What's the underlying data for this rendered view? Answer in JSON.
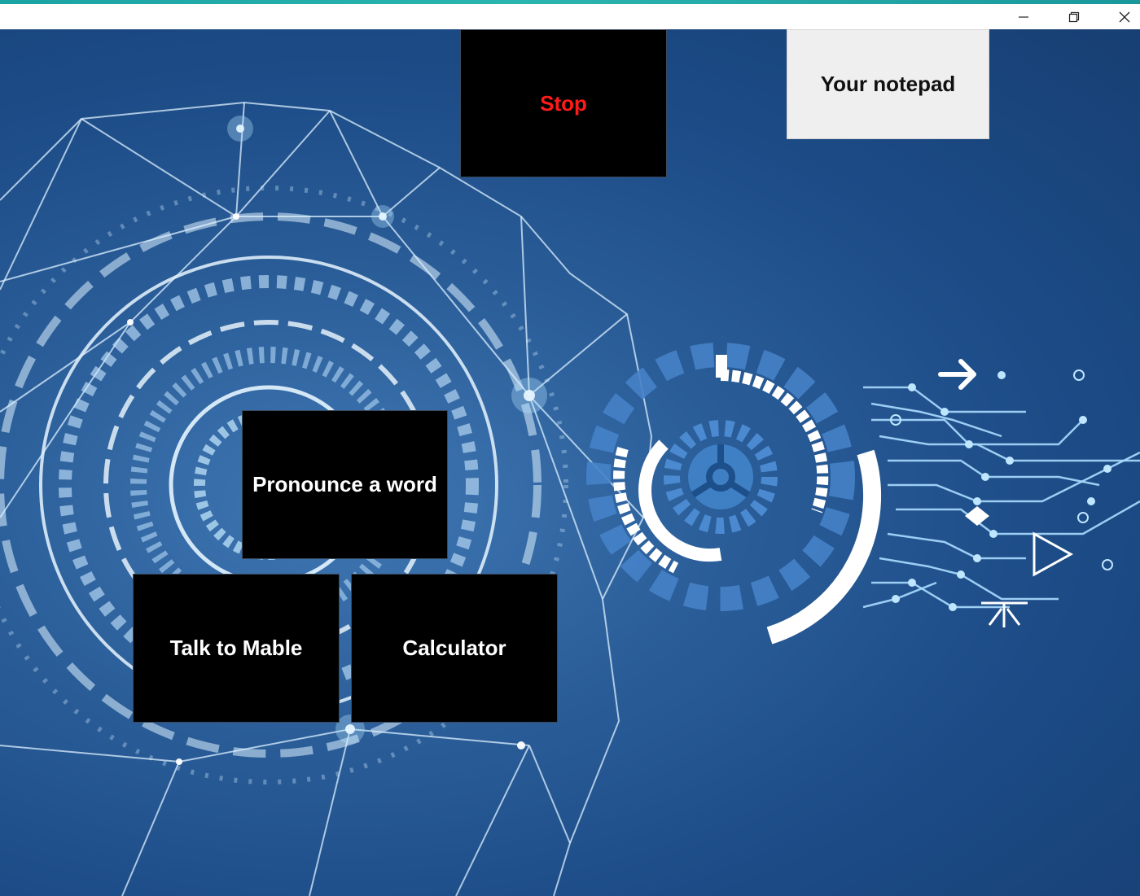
{
  "window": {
    "controls": {
      "minimize_icon": "minimize-icon",
      "restore_icon": "restore-icon",
      "close_icon": "close-icon"
    }
  },
  "buttons": {
    "stop": "Stop",
    "notepad": "Your notepad",
    "pronounce": "Pronounce a word",
    "talk": "Talk to Mable",
    "calculator": "Calculator"
  },
  "colors": {
    "accent_strip": "#1aa3a3",
    "stop_text": "#ff1a1a",
    "button_bg": "#000000",
    "notepad_bg": "#efefef",
    "background": "#1c4b86"
  }
}
